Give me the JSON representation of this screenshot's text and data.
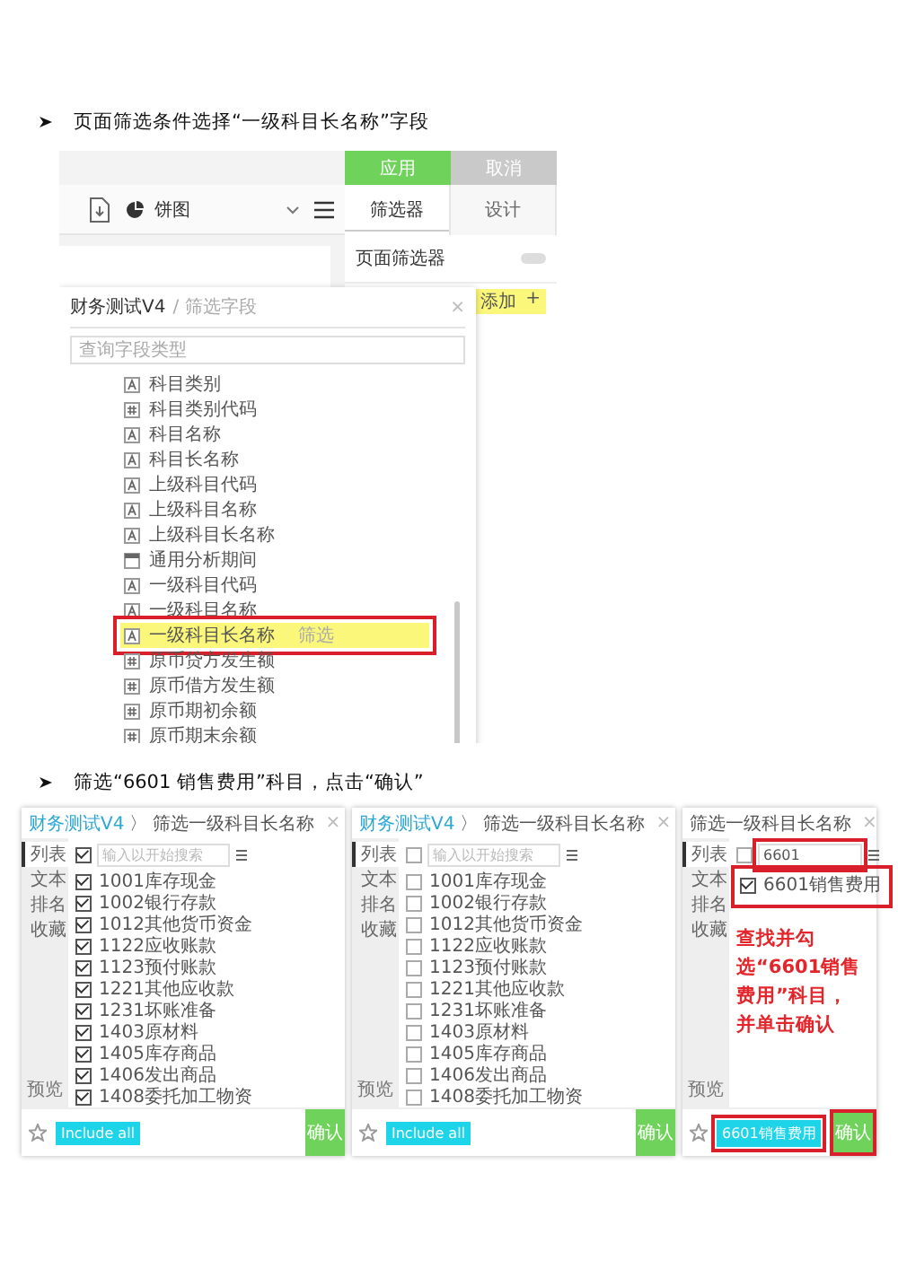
{
  "step_1": {
    "heading": "页面筛选条件选择“一级科目长名称”字段",
    "toolbar": {
      "chart_type": "饼图"
    },
    "side_panel": {
      "apply_button": "应用",
      "cancel_button": "取消",
      "tabs": [
        {
          "label": "筛选器",
          "selected": true
        },
        {
          "label": "设计",
          "selected": false
        }
      ],
      "page_filter": {
        "label": "页面筛选器",
        "on": false
      },
      "add_button": "添加",
      "add_icon": "+"
    },
    "field_dialog": {
      "title": "财务测试V4",
      "subtitle": "/ 筛选字段",
      "close": "×",
      "search": {
        "placeholder": "查询字段类型"
      },
      "fields": [
        {
          "kind": "text",
          "label": "科目类别",
          "selected": false
        },
        {
          "kind": "number",
          "label": "科目类别代码",
          "selected": false
        },
        {
          "kind": "text",
          "label": "科目名称",
          "selected": false
        },
        {
          "kind": "text",
          "label": "科目长名称",
          "selected": false
        },
        {
          "kind": "text",
          "label": "上级科目代码",
          "selected": false
        },
        {
          "kind": "text",
          "label": "上级科目名称",
          "selected": false
        },
        {
          "kind": "text",
          "label": "上级科目长名称",
          "selected": false
        },
        {
          "kind": "date",
          "label": "通用分析期间",
          "selected": false
        },
        {
          "kind": "text",
          "label": "一级科目代码",
          "selected": false
        },
        {
          "kind": "text",
          "label": "一级科目名称",
          "selected": false
        },
        {
          "kind": "text",
          "label": "一级科目长名称",
          "selected": true,
          "tag": "筛选"
        },
        {
          "kind": "number",
          "label": "原币贷方发生额",
          "selected": false
        },
        {
          "kind": "number",
          "label": "原币借方发生额",
          "selected": false
        },
        {
          "kind": "number",
          "label": "原币期初余额",
          "selected": false
        },
        {
          "kind": "number",
          "label": "原币期末余额",
          "selected": false
        }
      ]
    }
  },
  "step_2": {
    "heading": "筛选“6601 销售费用”科目，点击“确认”",
    "panels": [
      {
        "breadcrumb": "财务测试V4",
        "separator": "〉",
        "title": "筛选一级科目长名称",
        "close": "×",
        "annotated": false,
        "categories": [
          {
            "label": "列表",
            "selected": true
          },
          {
            "label": "文本",
            "selected": false
          },
          {
            "label": "排名",
            "selected": false
          },
          {
            "label": "收藏",
            "selected": false
          }
        ],
        "preview": "预览",
        "search": {
          "placeholder": "输入以开始搜索"
        },
        "select_all_checked": true,
        "items": [
          {
            "label": "1001库存现金",
            "checked": true
          },
          {
            "label": "1002银行存款",
            "checked": true
          },
          {
            "label": "1012其他货币资金",
            "checked": true
          },
          {
            "label": "1122应收账款",
            "checked": true
          },
          {
            "label": "1123预付账款",
            "checked": true
          },
          {
            "label": "1221其他应收款",
            "checked": true
          },
          {
            "label": "1231坏账准备",
            "checked": true
          },
          {
            "label": "1403原材料",
            "checked": true
          },
          {
            "label": "1405库存商品",
            "checked": true
          },
          {
            "label": "1406发出商品",
            "checked": true
          },
          {
            "label": "1408委托加工物资",
            "checked": true
          }
        ],
        "footer_tag": "Include all",
        "confirm_button": "确认"
      },
      {
        "breadcrumb": "财务测试V4",
        "separator": "〉",
        "title": "筛选一级科目长名称",
        "close": "×",
        "annotated": false,
        "categories": [
          {
            "label": "列表",
            "selected": true
          },
          {
            "label": "文本",
            "selected": false
          },
          {
            "label": "排名",
            "selected": false
          },
          {
            "label": "收藏",
            "selected": false
          }
        ],
        "preview": "预览",
        "search": {
          "placeholder": "输入以开始搜索"
        },
        "select_all_checked": false,
        "items": [
          {
            "label": "1001库存现金",
            "checked": false
          },
          {
            "label": "1002银行存款",
            "checked": false
          },
          {
            "label": "1012其他货币资金",
            "checked": false
          },
          {
            "label": "1122应收账款",
            "checked": false
          },
          {
            "label": "1123预付账款",
            "checked": false
          },
          {
            "label": "1221其他应收款",
            "checked": false
          },
          {
            "label": "1231坏账准备",
            "checked": false
          },
          {
            "label": "1403原材料",
            "checked": false
          },
          {
            "label": "1405库存商品",
            "checked": false
          },
          {
            "label": "1406发出商品",
            "checked": false
          },
          {
            "label": "1408委托加工物资",
            "checked": false
          }
        ],
        "footer_tag": "Include all",
        "confirm_button": "确认"
      },
      {
        "title": "筛选一级科目长名称",
        "close": "×",
        "annotated": true,
        "categories": [
          {
            "label": "列表",
            "selected": true
          },
          {
            "label": "文本",
            "selected": false
          },
          {
            "label": "排名",
            "selected": false
          },
          {
            "label": "收藏",
            "selected": false
          }
        ],
        "preview": "预览",
        "search": {
          "value": "6601"
        },
        "select_all_checked": false,
        "items": [
          {
            "label": "6601销售费用",
            "checked": true
          }
        ],
        "annotation": "查找并勾选“6601销售费用”科目，并单击确认",
        "footer_tag": "6601销售费用",
        "confirm_button": "确认"
      }
    ]
  }
}
